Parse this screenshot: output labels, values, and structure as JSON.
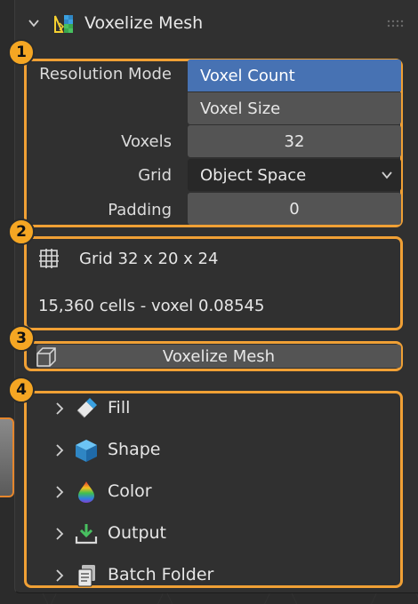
{
  "panel": {
    "title": "Voxelize Mesh",
    "header_icon": "voxelize-mesh-icon"
  },
  "callouts": [
    "1",
    "2",
    "3",
    "4"
  ],
  "settings": {
    "resolution_mode_label": "Resolution Mode",
    "resolution_mode_options": [
      "Voxel Count",
      "Voxel Size"
    ],
    "resolution_mode_selected": "Voxel Count",
    "voxels_label": "Voxels",
    "voxels_value": "32",
    "grid_label": "Grid",
    "grid_value": "Object Space",
    "padding_label": "Padding",
    "padding_value": "0"
  },
  "info": {
    "grid_text": "Grid 32 x 20 x 24",
    "cells_text": "15,360 cells - voxel 0.08545",
    "icon": "grid-icon"
  },
  "action": {
    "label": "Voxelize Mesh",
    "icon": "cube-outline-icon"
  },
  "subpanels": [
    {
      "label": "Fill",
      "icon": "eraser-fill-icon"
    },
    {
      "label": "Shape",
      "icon": "cube-icon"
    },
    {
      "label": "Color",
      "icon": "color-drop-icon"
    },
    {
      "label": "Output",
      "icon": "download-tray-icon"
    },
    {
      "label": "Batch Folder",
      "icon": "documents-icon"
    }
  ],
  "colors": {
    "accent_orange": "#f0a035",
    "selected_blue": "#4772b3",
    "panel_bg": "#303030",
    "field_bg": "#545454"
  }
}
